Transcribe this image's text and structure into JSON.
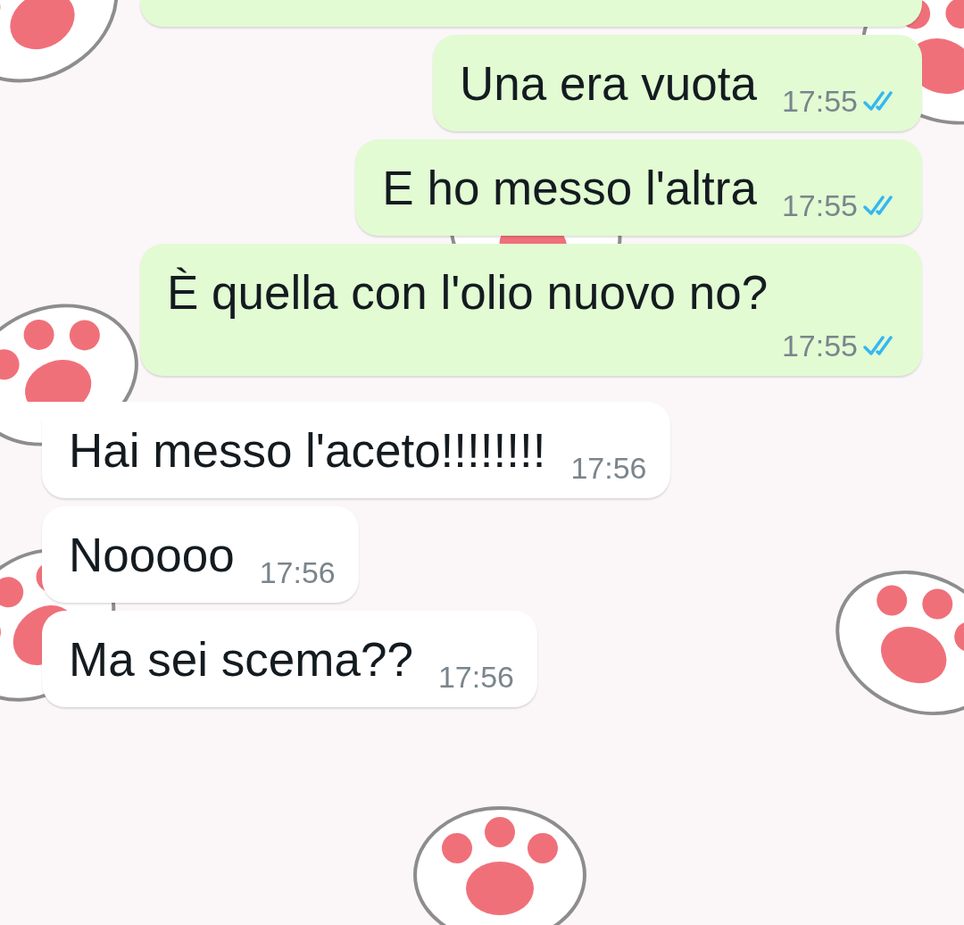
{
  "messages": [
    {
      "kind": "outgoing_cut"
    },
    {
      "kind": "outgoing",
      "text": "Una era vuota",
      "time": "17:55",
      "read": true
    },
    {
      "kind": "outgoing",
      "text": "E ho messo l'altra",
      "time": "17:55",
      "read": true
    },
    {
      "kind": "outgoing",
      "text": "È quella con l'olio nuovo no?",
      "time": "17:55",
      "read": true
    },
    {
      "kind": "incoming",
      "first": true,
      "text": "Hai messo l'aceto!!!!!!!!",
      "time": "17:56"
    },
    {
      "kind": "incoming",
      "first": false,
      "text": "Nooooo",
      "time": "17:56"
    },
    {
      "kind": "incoming",
      "first": false,
      "text": "Ma sei scema??",
      "time": "17:56"
    }
  ]
}
